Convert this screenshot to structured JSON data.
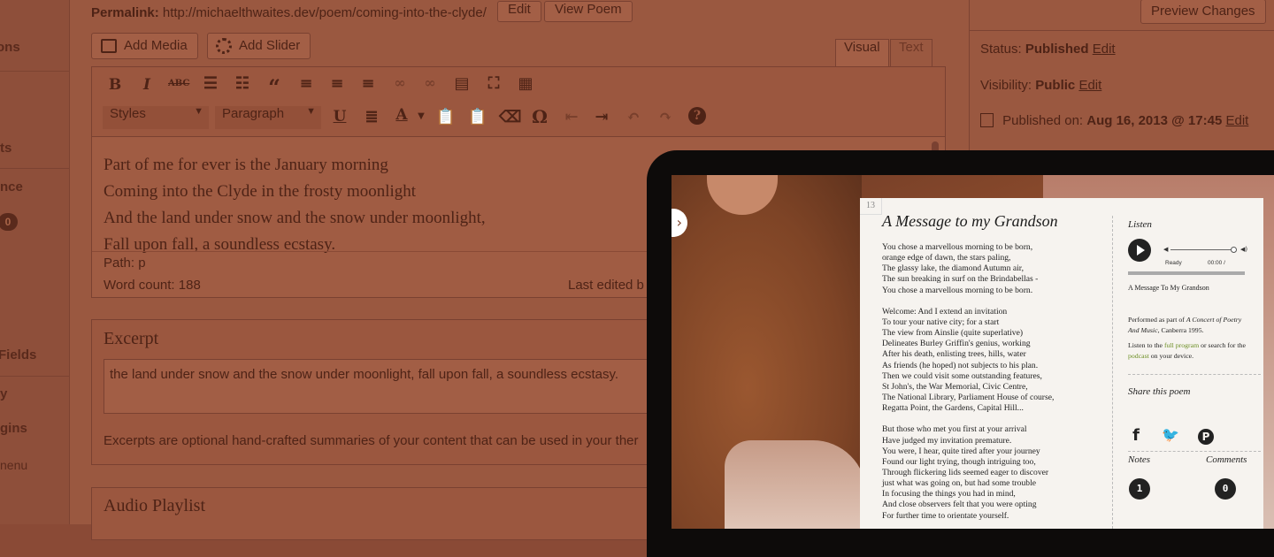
{
  "sidebar": {
    "items": [
      "ons",
      "ts",
      "nce",
      "Fields",
      "y",
      "gins",
      "nenu"
    ],
    "badge": "0"
  },
  "editor": {
    "permalink_label": "Permalink:",
    "permalink_url": "http://michaelthwaites.dev/poem/coming-into-the-clyde/",
    "edit_button": "Edit",
    "view_button": "View Poem",
    "add_media": "Add Media",
    "add_slider": "Add Slider",
    "tab_visual": "Visual",
    "tab_text": "Text",
    "styles_select": "Styles",
    "paragraph_select": "Paragraph",
    "content_lines": [
      "Part of me for ever is the January morning",
      "Coming into the Clyde in the frosty moonlight",
      "And the land under snow and the snow under moonlight,",
      "Fall upon fall, a soundless ecstasy."
    ],
    "path": "Path: p",
    "word_count": "Word count: 188",
    "last_edited": "Last edited b"
  },
  "excerpt": {
    "title": "Excerpt",
    "value": "the land under snow and the snow under moonlight, fall upon fall, a soundless ecstasy.",
    "help": "Excerpts are optional hand-crafted summaries of your content that can be used in your ther"
  },
  "audio_playlist": {
    "title": "Audio Playlist"
  },
  "publish": {
    "preview_button": "Preview Changes",
    "status_label": "Status:",
    "status_value": "Published",
    "visibility_label": "Visibility:",
    "visibility_value": "Public",
    "published_label": "Published on:",
    "published_value": "Aug 16, 2013 @ 17:45",
    "edit_link": "Edit"
  },
  "tablet": {
    "page_number": "13",
    "poem_title": "A Message to my Grandson",
    "stanzas": [
      [
        "You chose a marvellous morning to be born,",
        "orange edge of dawn, the stars paling,",
        "The glassy lake, the diamond Autumn air,",
        "The sun breaking in surf on the Brindabellas -",
        "You chose a marvellous morning to be born."
      ],
      [
        "Welcome: And I extend an invitation",
        "To tour your native city; for a start",
        "The view from Ainslie (quite superlative)",
        "Delineates Burley Griffin's genius, working",
        "After his death, enlisting trees, hills, water",
        "As friends (he hoped) not subjects to his plan.",
        "Then we could visit some outstanding features,",
        "St John's, the War Memorial, Civic Centre,",
        "The National Library, Parliament House of course,",
        "Regatta Point, the Gardens, Capital Hill..."
      ],
      [
        "But those who met you first at your arrival",
        "Have judged my invitation premature.",
        "You were, I hear, quite tired after your journey",
        "Found our light trying, though intriguing too,",
        "Through flickering lids seemed eager to discover",
        "just what was going on, but had some trouble",
        "In focusing the things you had in mind,",
        "And close observers felt that you were opting",
        "For further time to orientate yourself."
      ]
    ],
    "listen_heading": "Listen",
    "player_status": "Ready",
    "player_time": "00:00 /",
    "track_title": "A Message To My Grandson",
    "performed_prefix": "Performed as part of ",
    "performed_concert": "A Concert of Poetry And Music",
    "performed_suffix": ", Canberra 1995.",
    "listen_prefix": "Listen to the ",
    "full_program": "full program",
    "listen_mid": " or search for the ",
    "podcast": "podcast",
    "listen_suffix": " on your device.",
    "share_heading": "Share this poem",
    "social_icons": [
      "facebook-icon",
      "twitter-icon",
      "pinterest-icon"
    ],
    "notes_heading": "Notes",
    "comments_heading": "Comments",
    "notes_count": "1",
    "comments_count": "0"
  },
  "colors": {
    "overlay": "#9a5840",
    "link_green": "#6b8e23",
    "tablet_bezel": "#0d0b0a"
  }
}
